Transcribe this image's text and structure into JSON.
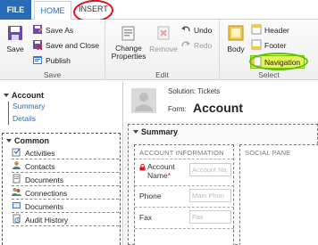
{
  "tabs": {
    "file": "FILE",
    "home": "HOME",
    "insert": "INSERT"
  },
  "ribbon": {
    "save_group": {
      "label": "Save",
      "save": "Save",
      "save_as": "Save As",
      "save_and_close": "Save and Close",
      "publish": "Publish"
    },
    "edit_group": {
      "label": "Edit",
      "change_properties_line1": "Change",
      "change_properties_line2": "Properties",
      "remove": "Remove",
      "undo": "Undo",
      "redo": "Redo"
    },
    "select_group": {
      "label": "Select",
      "body": "Body",
      "header": "Header",
      "footer": "Footer",
      "navigation": "Navigation"
    }
  },
  "leftnav": {
    "account": {
      "title": "Account",
      "links": [
        "Summary",
        "Details"
      ]
    },
    "common": {
      "title": "Common",
      "items": [
        "Activities",
        "Contacts",
        "Documents",
        "Connections",
        "Documents",
        "Audit History"
      ]
    }
  },
  "form": {
    "solution": "Solution: Tickets",
    "form_label": "Form:",
    "form_name": "Account",
    "tab_title": "Summary",
    "account_section_title": "ACCOUNT INFORMATION",
    "social_pane_title": "SOCIAL PANE",
    "fields": [
      {
        "label": "Account Name",
        "required_mark": "*",
        "placeholder": "Account Na"
      },
      {
        "label": "Phone",
        "required_mark": "",
        "placeholder": "Main Phon"
      },
      {
        "label": "Fax",
        "required_mark": "",
        "placeholder": "Fax"
      }
    ]
  },
  "colors": {
    "file_tab": "#2a6bb8",
    "link": "#2a6bb8",
    "insert_annotation": "#d8131b",
    "navigation_highlight": "#e6f35a",
    "navigation_annotation": "#5cc10d"
  }
}
